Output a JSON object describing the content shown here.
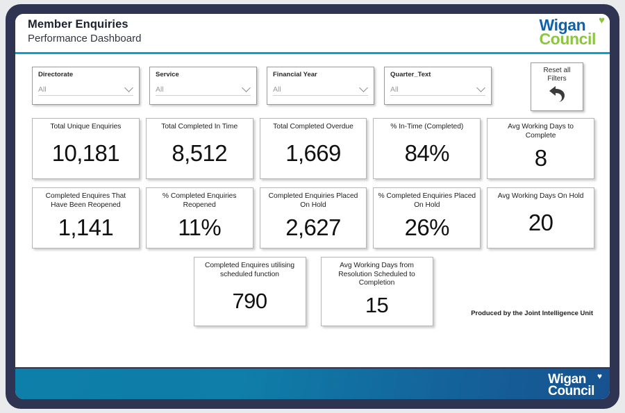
{
  "header": {
    "title": "Member Enquiries",
    "subtitle": "Performance Dashboard",
    "logo": {
      "word1": "Wigan",
      "word2": "Council",
      "heart": "♥",
      "color_blue": "#0b63ad",
      "color_green": "#8cc63e"
    },
    "rule_color": "#00a3d3"
  },
  "filters": [
    {
      "label": "Directorate",
      "value": "All",
      "placeholder": "All"
    },
    {
      "label": "Service",
      "value": "All",
      "placeholder": "All"
    },
    {
      "label": "Financial Year",
      "value": "All",
      "placeholder": "All"
    },
    {
      "label": "Quarter_Text",
      "value": "All",
      "placeholder": "All"
    }
  ],
  "reset_button": {
    "line1": "Reset all",
    "line2": "Filters",
    "icon": "undo-arrow-icon"
  },
  "kpi_rows": [
    [
      {
        "label": "Total Unique Enquiries",
        "value": "10,181"
      },
      {
        "label": "Total Completed In Time",
        "value": "8,512"
      },
      {
        "label": "Total Completed Overdue",
        "value": "1,669"
      },
      {
        "label": "% In-Time (Completed)",
        "value": "84%"
      },
      {
        "label": "Avg Working Days to Complete",
        "value": "8"
      }
    ],
    [
      {
        "label": "Completed Enquires That Have Been Reopened",
        "value": "1,141"
      },
      {
        "label": "% Completed Enquiries Reopened",
        "value": "11%"
      },
      {
        "label": "Completed Enquiries Placed On Hold",
        "value": "2,627"
      },
      {
        "label": "% Completed Enquiries Placed On Hold",
        "value": "26%"
      },
      {
        "label": "Avg Working Days On Hold",
        "value": "20"
      }
    ],
    [
      {
        "label": "Completed Enquires utilising scheduled function",
        "value": "790"
      },
      {
        "label": "Avg Working Days from Resolution Scheduled to Completion",
        "value": "15"
      }
    ]
  ],
  "credit": "Produced by the Joint Intelligence Unit",
  "footer": {
    "logo": {
      "word1": "Wigan",
      "word2": "Council",
      "heart": "♥"
    }
  }
}
